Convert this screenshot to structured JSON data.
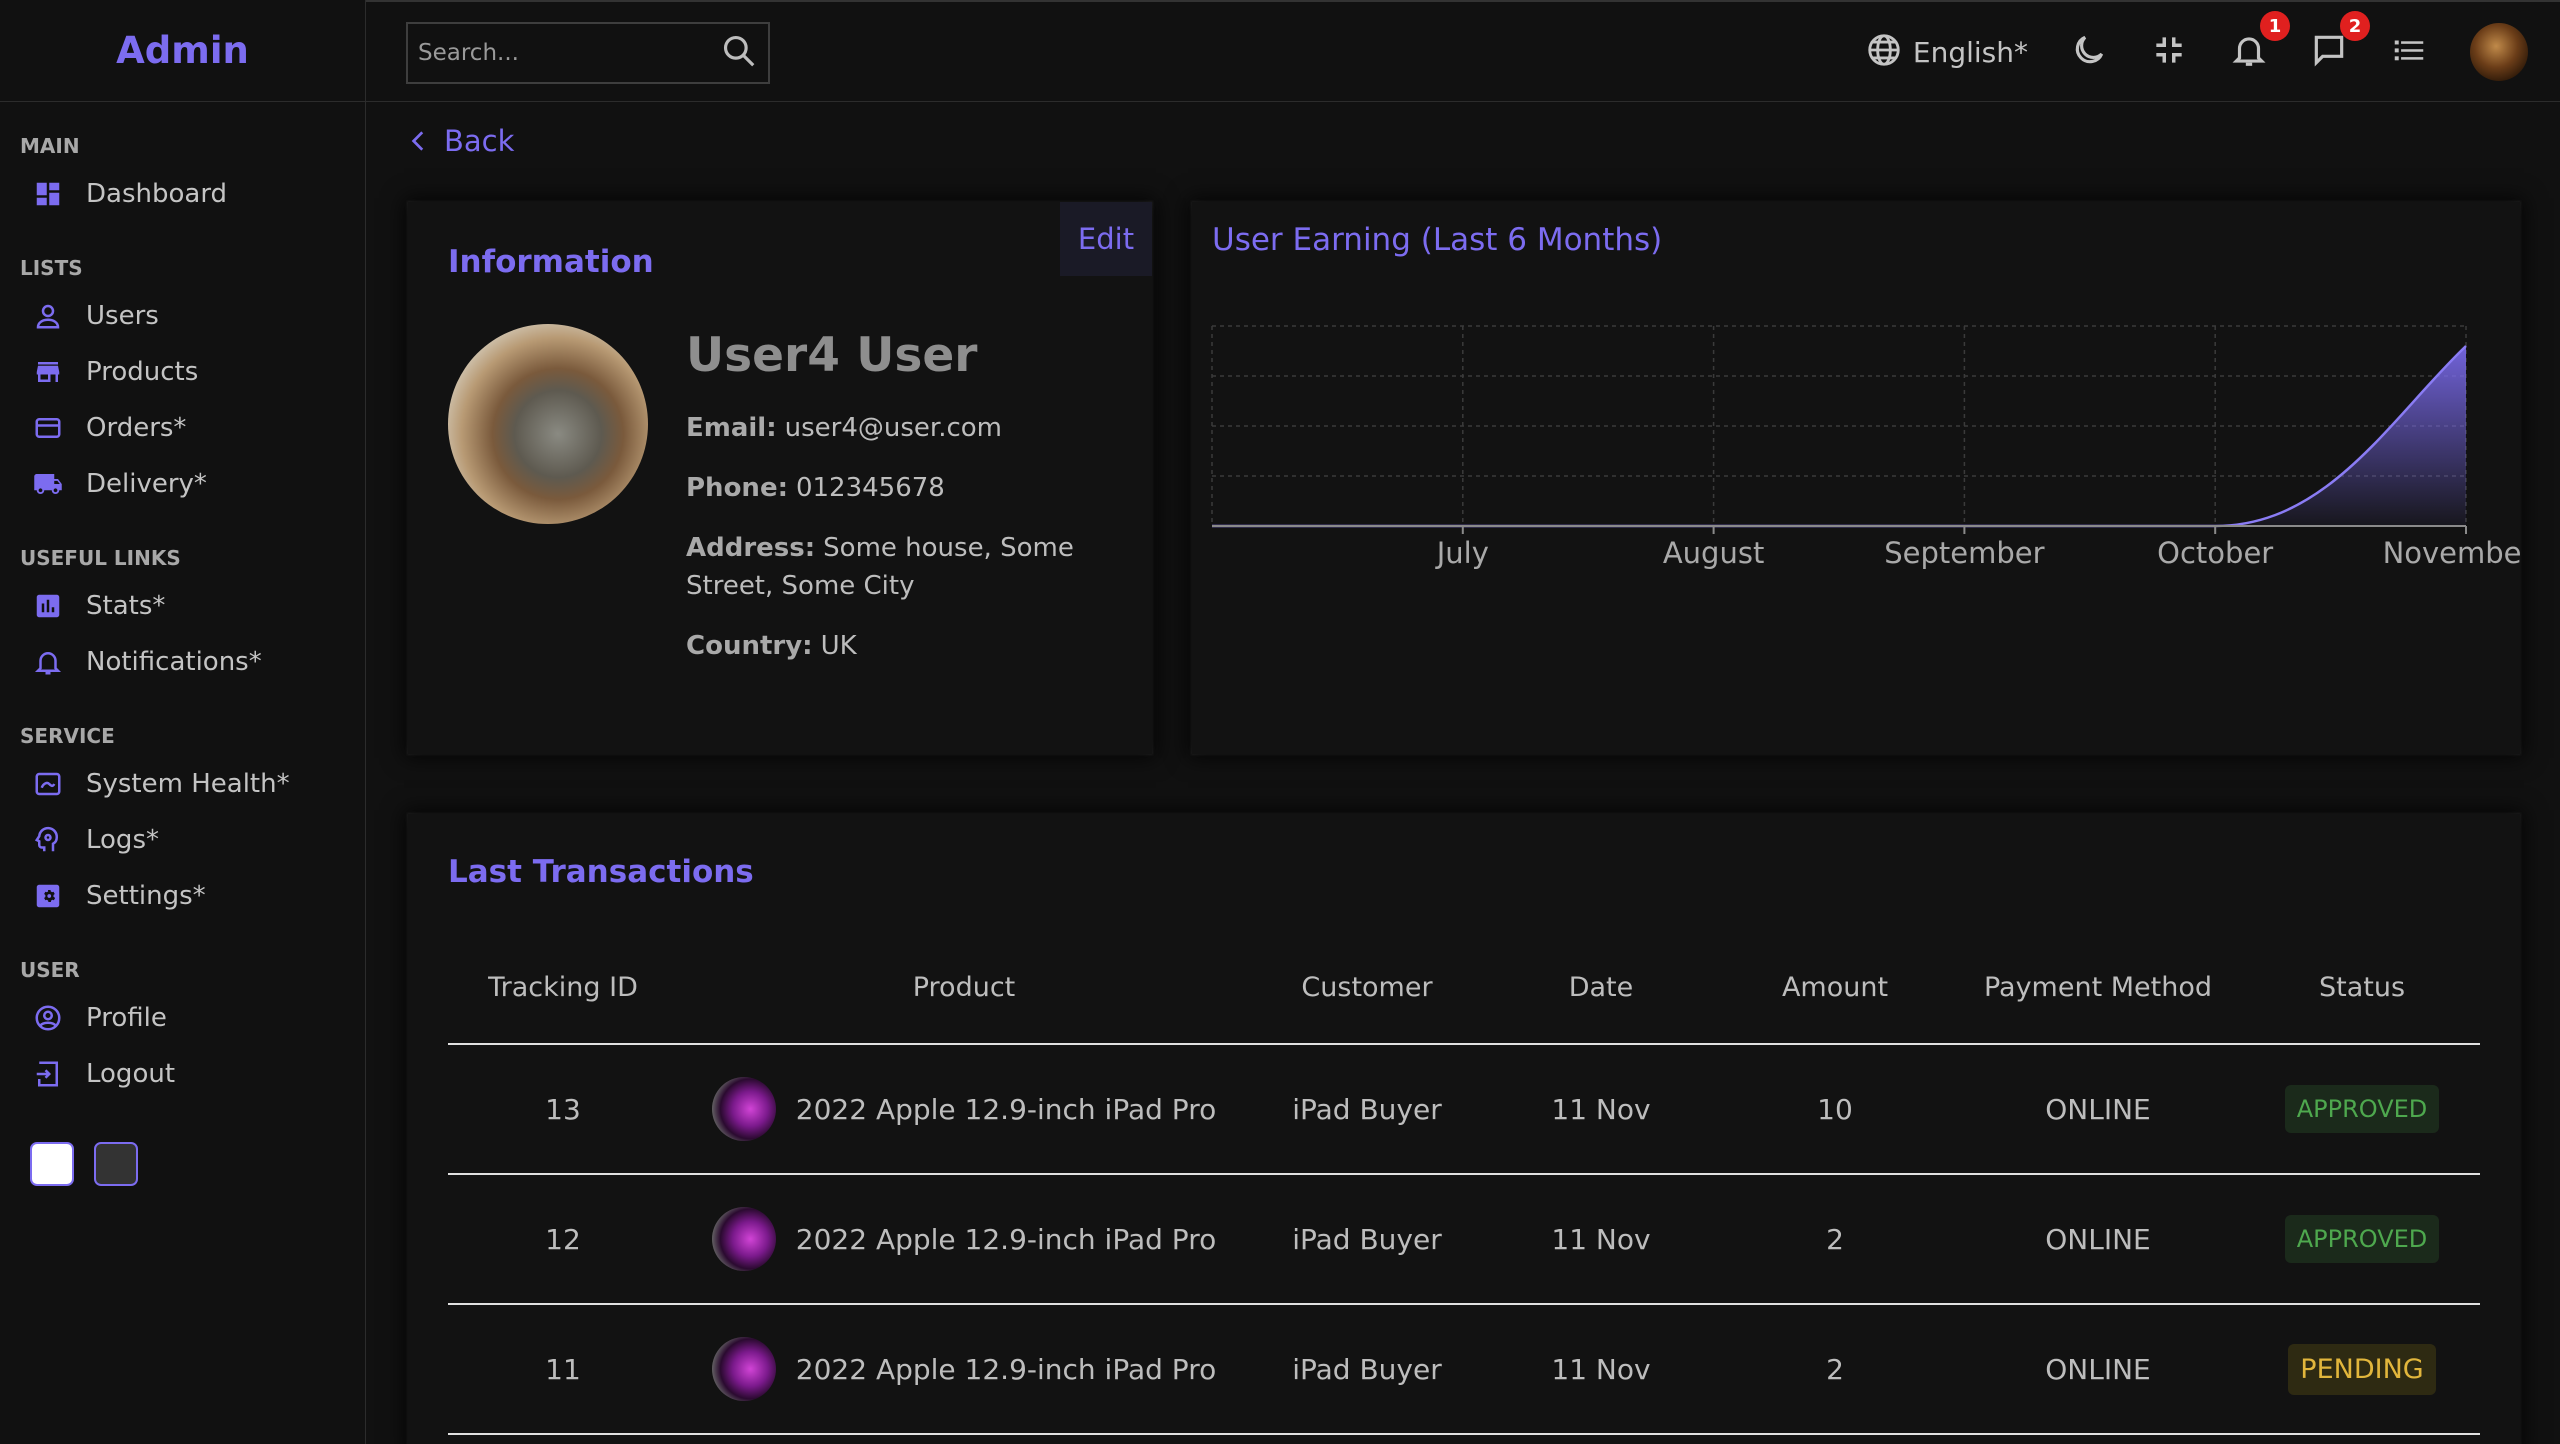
{
  "sidebar": {
    "logo": "Admin",
    "sections": [
      {
        "title": "MAIN",
        "items": [
          {
            "label": "Dashboard",
            "icon": "dashboard-icon"
          }
        ]
      },
      {
        "title": "LISTS",
        "items": [
          {
            "label": "Users",
            "icon": "user-icon"
          },
          {
            "label": "Products",
            "icon": "store-icon"
          },
          {
            "label": "Orders*",
            "icon": "credit-card-icon"
          },
          {
            "label": "Delivery*",
            "icon": "truck-icon"
          }
        ]
      },
      {
        "title": "USEFUL LINKS",
        "items": [
          {
            "label": "Stats*",
            "icon": "bar-chart-icon"
          },
          {
            "label": "Notifications*",
            "icon": "bell-icon"
          }
        ]
      },
      {
        "title": "SERVICE",
        "items": [
          {
            "label": "System Health*",
            "icon": "system-health-icon"
          },
          {
            "label": "Logs*",
            "icon": "psychology-icon"
          },
          {
            "label": "Settings*",
            "icon": "settings-icon"
          }
        ]
      },
      {
        "title": "USER",
        "items": [
          {
            "label": "Profile",
            "icon": "account-circle-icon"
          },
          {
            "label": "Logout",
            "icon": "logout-icon"
          }
        ]
      }
    ],
    "themes": [
      {
        "name": "light",
        "color": "#ffffff"
      },
      {
        "name": "dark",
        "color": "#333333"
      }
    ]
  },
  "topbar": {
    "search_placeholder": "Search...",
    "language": "English*",
    "notifications_count": "1",
    "messages_count": "2"
  },
  "main": {
    "back_label": "Back",
    "info": {
      "title": "Information",
      "edit_label": "Edit",
      "name": "User4 User",
      "email_label": "Email:",
      "email": "user4@user.com",
      "phone_label": "Phone:",
      "phone": "012345678",
      "address_label": "Address:",
      "address": "Some house, Some Street, Some City",
      "country_label": "Country:",
      "country": "UK"
    },
    "transactions": {
      "title": "Last Transactions",
      "columns": [
        "Tracking ID",
        "Product",
        "Customer",
        "Date",
        "Amount",
        "Payment Method",
        "Status"
      ],
      "rows": [
        {
          "id": "13",
          "product": "2022 Apple 12.9-inch iPad Pro",
          "customer": "iPad Buyer",
          "date": "11 Nov",
          "amount": "10",
          "method": "ONLINE",
          "status": "APPROVED"
        },
        {
          "id": "12",
          "product": "2022 Apple 12.9-inch iPad Pro",
          "customer": "iPad Buyer",
          "date": "11 Nov",
          "amount": "2",
          "method": "ONLINE",
          "status": "APPROVED"
        },
        {
          "id": "11",
          "product": "2022 Apple 12.9-inch iPad Pro",
          "customer": "iPad Buyer",
          "date": "11 Nov",
          "amount": "2",
          "method": "ONLINE",
          "status": "PENDING"
        }
      ]
    }
  },
  "colors": {
    "accent": "#7c6cf0",
    "approved": "#4ea84e",
    "pending": "#e2b63c",
    "badge": "#e0201f"
  },
  "chart_data": {
    "type": "area",
    "title": "User Earning (Last 6 Months)",
    "categories": [
      "July",
      "August",
      "September",
      "October",
      "November"
    ],
    "values": [
      0,
      0,
      0,
      0,
      90
    ],
    "xlabel": "",
    "ylabel": "",
    "ylim": [
      0,
      100
    ],
    "grid": true,
    "legend": "none"
  }
}
